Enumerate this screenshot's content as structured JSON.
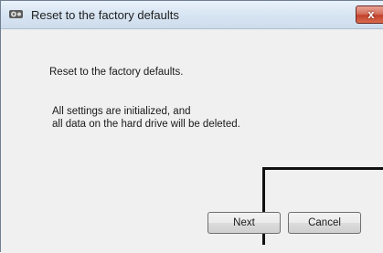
{
  "window": {
    "title": "Reset to the factory defaults",
    "close_label": "x"
  },
  "content": {
    "heading": "Reset to the factory defaults.",
    "detail_line1": "All settings are initialized, and",
    "detail_line2": "all data on the hard drive will be deleted."
  },
  "buttons": {
    "next_label": "Next",
    "cancel_label": "Cancel"
  },
  "icons": {
    "title": "settings-app-icon",
    "close": "close-icon"
  },
  "colors": {
    "close_button": "#c2412c",
    "titlebar": "#d9e6f3",
    "background": "#f0f0f0"
  }
}
